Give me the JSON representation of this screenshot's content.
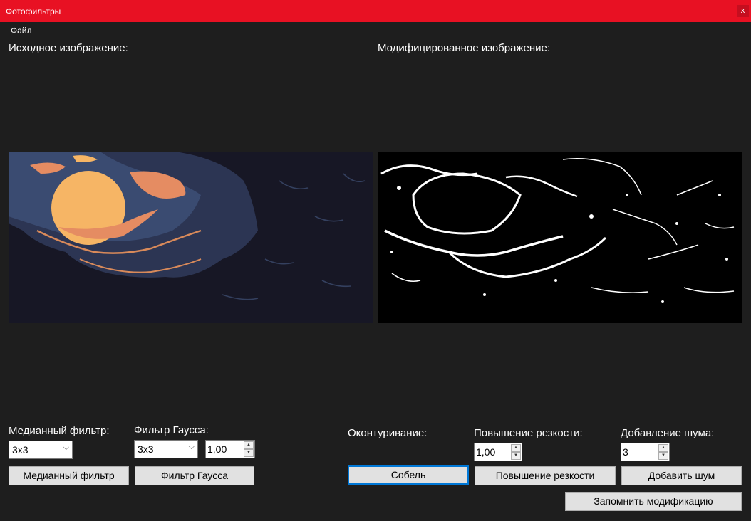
{
  "window": {
    "title": "Фотофильтры",
    "close_label": "x"
  },
  "menu": {
    "file": "Файл"
  },
  "source": {
    "label": "Исходное изображение:"
  },
  "modified": {
    "label": "Модифицированное изображение:"
  },
  "median": {
    "label": "Медианный фильтр:",
    "selected": "3x3",
    "button": "Медианный фильтр"
  },
  "gauss": {
    "label": "Фильтр Гаусса:",
    "selected": "3x3",
    "sigma": "1,00",
    "button": "Фильтр Гаусса"
  },
  "contour": {
    "label": "Оконтуривание:",
    "button": "Собель"
  },
  "sharpen": {
    "label": "Повышение резкости:",
    "value": "1,00",
    "button": "Повышение резкости"
  },
  "noise": {
    "label": "Добавление шума:",
    "value": "3",
    "button": "Добавить шум"
  },
  "save_button": "Запомнить модификацию",
  "colors": {
    "titlebar": "#e81123",
    "background": "#1e1e1e",
    "focus": "#0078d7"
  }
}
